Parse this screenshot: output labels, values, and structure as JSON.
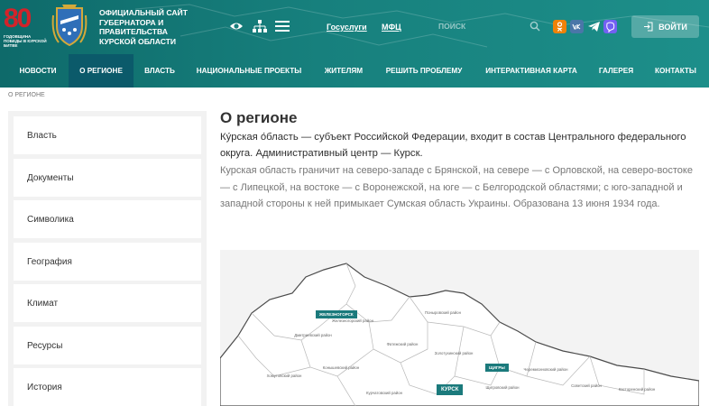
{
  "header": {
    "logo80": {
      "number": "80",
      "caption": "ГОДОВЩИНА ПОБЕДЫ В КУРСКОЙ БИТВЕ"
    },
    "site_title": "ОФИЦИАЛЬНЫЙ САЙТ ГУБЕРНАТОРА И ПРАВИТЕЛЬСТВА КУРСКОЙ ОБЛАСТИ",
    "links": {
      "gosuslugi": "Госуслуги",
      "mfc": "МФЦ"
    },
    "search": {
      "placeholder": "ПОИСК"
    },
    "login_label": "ВОЙТИ",
    "colors": {
      "header_bg": "#17807d",
      "nav_active": "#0b5a6a",
      "accent_red": "#d3232a"
    }
  },
  "nav": [
    {
      "label": "НОВОСТИ"
    },
    {
      "label": "О РЕГИОНЕ"
    },
    {
      "label": "ВЛАСТЬ"
    },
    {
      "label": "НАЦИОНАЛЬНЫЕ ПРОЕКТЫ"
    },
    {
      "label": "ЖИТЕЛЯМ"
    },
    {
      "label": "РЕШИТЬ ПРОБЛЕМУ"
    },
    {
      "label": "ИНТЕРАКТИВНАЯ КАРТА"
    },
    {
      "label": "ГАЛЕРЕЯ"
    },
    {
      "label": "КОНТАКТЫ"
    }
  ],
  "breadcrumb": "О РЕГИОНЕ",
  "sidebar": {
    "items": [
      {
        "label": "Власть"
      },
      {
        "label": "Документы"
      },
      {
        "label": "Символика"
      },
      {
        "label": "География"
      },
      {
        "label": "Климат"
      },
      {
        "label": "Ресурсы"
      },
      {
        "label": "История"
      }
    ]
  },
  "main": {
    "title": "О регионе",
    "lead": "Ку́рская о́бласть — субъект Российской Федерации, входит в состав Центрального федерального округа. Административный центр — Курск.",
    "paragraph": "Курская область граничит на северо-западе с Брянской, на севере — с Орловской, на северо-востоке — с Липецкой, на востоке — с Воронежской, на юге — с Белгородской областями; с юго-западной и западной стороны к ней примыкает Сумская область Украины. Образована 13 июня 1934 года."
  },
  "map": {
    "cities": {
      "zheleznogorsk": "ЖЕЛЕЗНОГОРСК",
      "shchigry": "ЩИГРЫ",
      "kursk": "КУРСК"
    },
    "districts": {
      "zheleznogorsky": "Железногорский район",
      "ponyrovsky": "Поныровский район",
      "dmitrievsky": "Дмитриевский район",
      "fatezhsky": "Фатежский район",
      "zolotukhinsky": "Золотухинский район",
      "konyshevsky": "Конышевский район",
      "cheremisinovsky": "Черемисиновский район",
      "khomutovsky": "Хомутовский район",
      "shchigrovsky": "Щигровский район",
      "kurchatovsky": "Курчатовский район",
      "sovetsky": "Советский район",
      "kastorensky": "Касторенский район"
    }
  }
}
